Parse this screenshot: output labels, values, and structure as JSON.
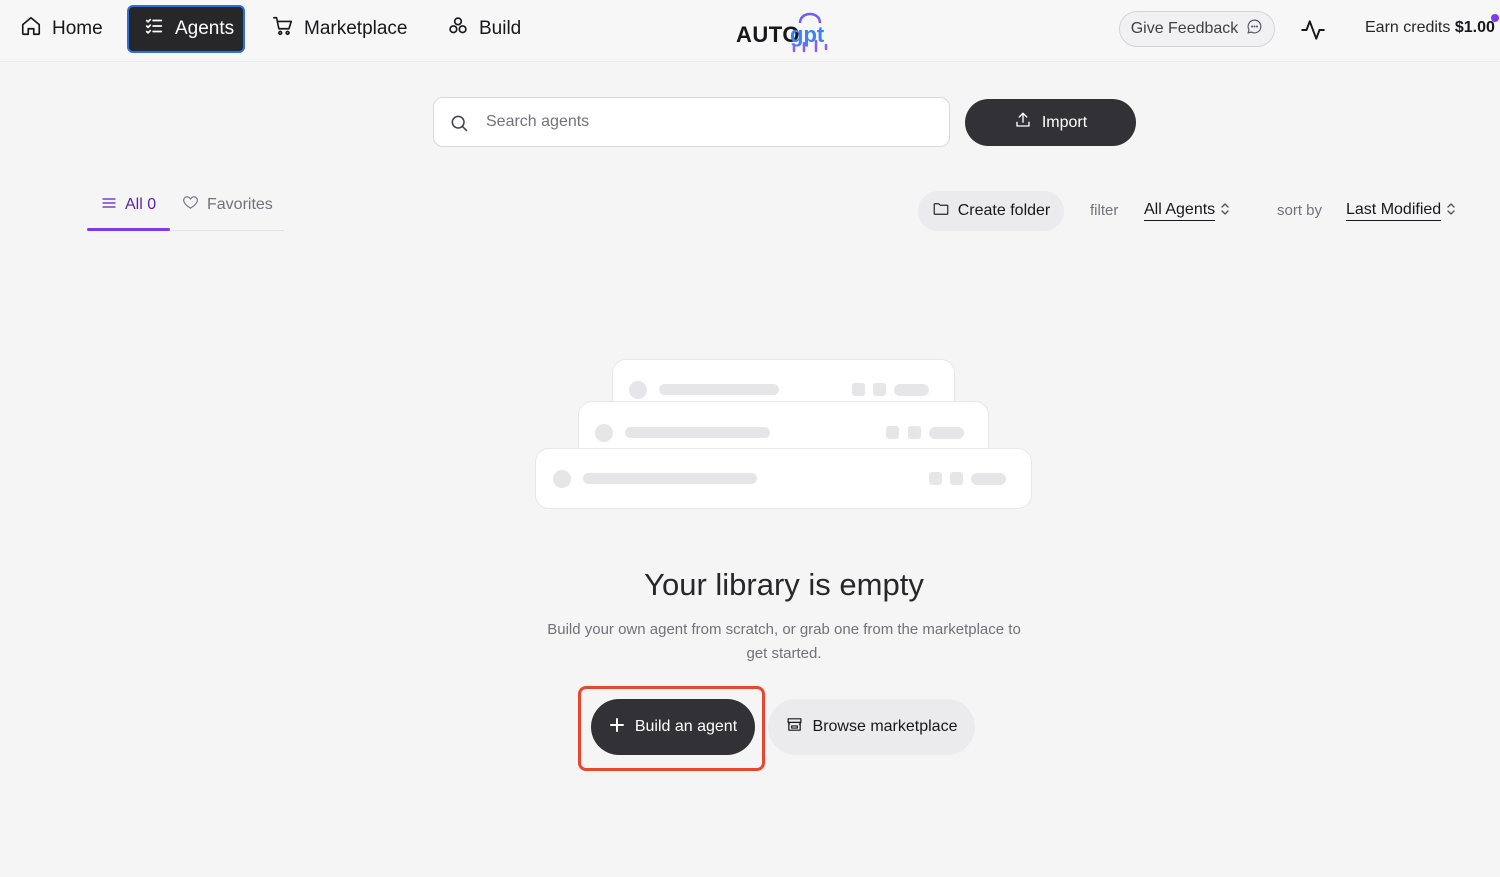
{
  "nav": {
    "home_label": "Home",
    "agents_label": "Agents",
    "marketplace_label": "Marketplace",
    "build_label": "Build",
    "active_item": "Agents"
  },
  "header": {
    "logo_text": "AUTOgpt",
    "feedback_label": "Give Feedback",
    "credits_label": "Earn credits",
    "credits_amount": "$1.00",
    "notification_dot_color": "#7c3aed"
  },
  "search": {
    "placeholder": "Search agents",
    "value": ""
  },
  "import_label": "Import",
  "tabs": {
    "all_label": "All 0",
    "favorites_label": "Favorites",
    "active": "All"
  },
  "controls": {
    "create_folder_label": "Create folder",
    "filter_label": "filter",
    "filter_value": "All Agents",
    "sort_label": "sort by",
    "sort_value": "Last Modified"
  },
  "empty_state": {
    "title": "Your library is empty",
    "description": "Build your own agent from scratch, or grab one from the marketplace to get started.",
    "build_button_label": "Build an agent",
    "browse_button_label": "Browse marketplace"
  },
  "colors": {
    "accent": "#7c3aed",
    "dark_button": "#323236",
    "highlight_outline": "#e8472f"
  },
  "icons": {
    "home": "home-icon",
    "agents": "list-icon",
    "marketplace": "cart-icon",
    "build": "build-icon",
    "feedback": "chat-bubble-icon",
    "activity": "activity-icon",
    "search": "search-icon",
    "import": "upload-icon",
    "all_tab": "list-icon",
    "favorites_tab": "heart-icon",
    "create_folder": "folder-icon",
    "build_agent": "plus-icon",
    "browse_marketplace": "store-icon"
  }
}
